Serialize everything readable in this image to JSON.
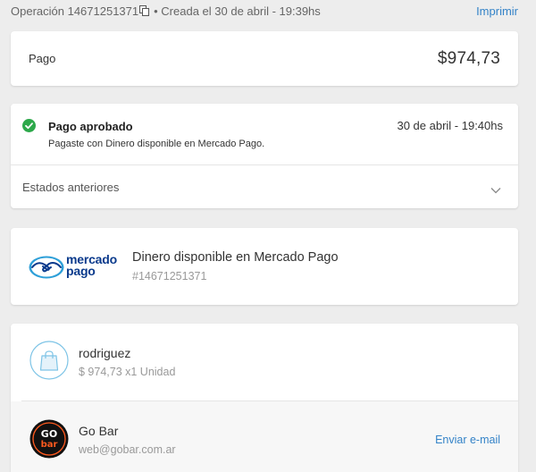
{
  "header": {
    "operation": "Operación 14671251371",
    "created": "• Creada el 30 de abril - 19:39hs",
    "print_label": "Imprimir"
  },
  "payment": {
    "label": "Pago",
    "amount": "$974,73"
  },
  "status": {
    "title": "Pago aprobado",
    "date": "30 de abril - 19:40hs",
    "description": "Pagaste con Dinero disponible en Mercado Pago.",
    "history_label": "Estados anteriores",
    "color": "#2ca84a"
  },
  "method": {
    "logo_line1": "mercado",
    "logo_line2": "pago",
    "title": "Dinero disponible en Mercado Pago",
    "subtitle": "#14671251371"
  },
  "seller": {
    "name": "rodriguez",
    "price": "$ 974,73 x1 Unidad"
  },
  "store": {
    "name": "Go Bar",
    "email": "web@gobar.com.ar",
    "logo_line1": "GO",
    "logo_line2": "bar",
    "send_email_label": "Enviar e-mail"
  },
  "icons": [
    "copy-icon",
    "check-circle-icon",
    "chevron-down-icon",
    "handshake-icon",
    "shopping-bag-icon",
    "gobar-logo"
  ],
  "colors": {
    "link": "#3483c8",
    "background": "#ededed",
    "brand_blue": "#0a3a8c",
    "brand_light_blue": "#2d9fd8"
  }
}
